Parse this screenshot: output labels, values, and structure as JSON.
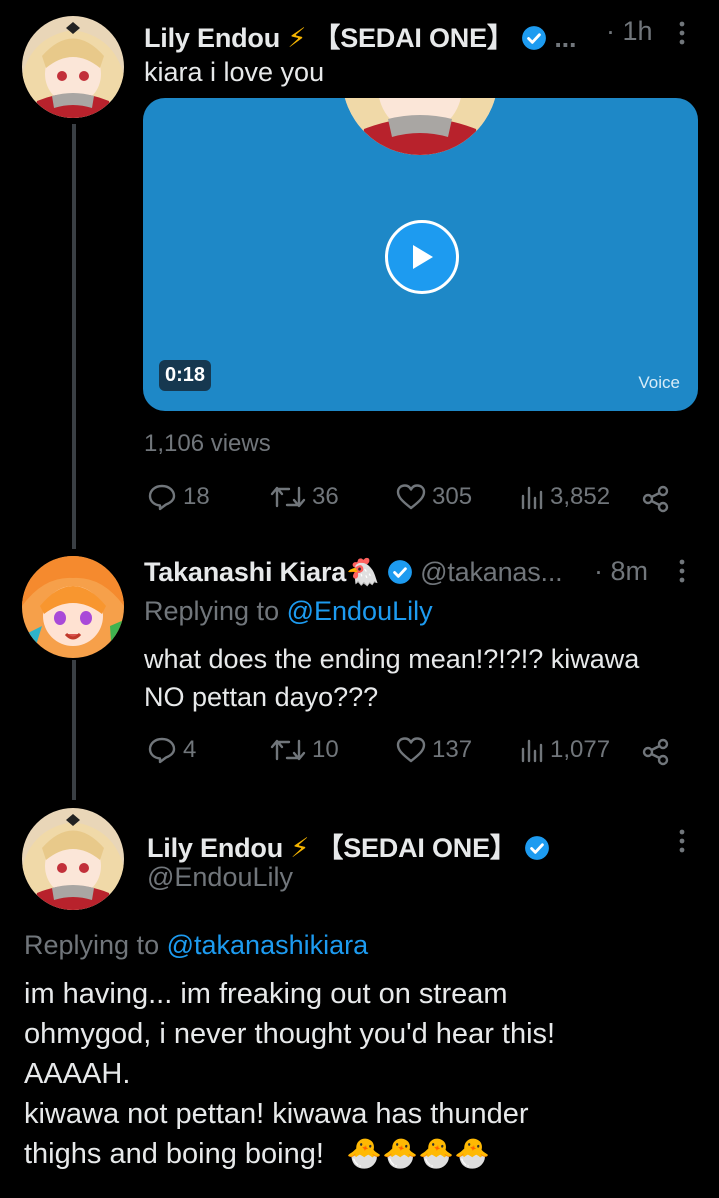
{
  "tweet1": {
    "author_name": "Lily Endou",
    "author_emoji": "⚡",
    "author_tag": "【SEDAI ONE】",
    "ellipsis": "...",
    "time": "· 1h",
    "text": "kiara i love you",
    "media": {
      "duration": "0:18",
      "label": "Voice"
    },
    "views": "1,106 views",
    "stats": {
      "replies": "18",
      "retweets": "36",
      "likes": "305",
      "views": "3,852"
    }
  },
  "tweet2": {
    "author_name": "Takanashi Kiara",
    "author_emoji": "🐔",
    "handle": "@takanas...",
    "time": "· 8m",
    "replying_prefix": "Replying to",
    "replying_to": "@EndouLily",
    "text_line1": "what does the ending mean!?!?!? kiwawa",
    "text_line2": "NO pettan dayo???",
    "stats": {
      "replies": "4",
      "retweets": "10",
      "likes": "137",
      "views": "1,077"
    }
  },
  "tweet3": {
    "author_name": "Lily Endou",
    "author_emoji": "⚡",
    "author_tag": "【SEDAI ONE】",
    "handle": "@EndouLily",
    "replying_prefix": "Replying to",
    "replying_to": "@takanashikiara",
    "lines": [
      "im having... im freaking out on stream",
      "ohmygod, i never thought you'd hear this!",
      "AAAAH.",
      "kiwawa not pettan! kiwawa has thunder",
      "thighs and boing boing!"
    ],
    "emojis": "🐣🐣🐣🐣"
  },
  "colors": {
    "background": "#000000",
    "text": "#e7e9ea",
    "muted": "#71767b",
    "link": "#1d9bf0",
    "media": "#1e88c7"
  }
}
